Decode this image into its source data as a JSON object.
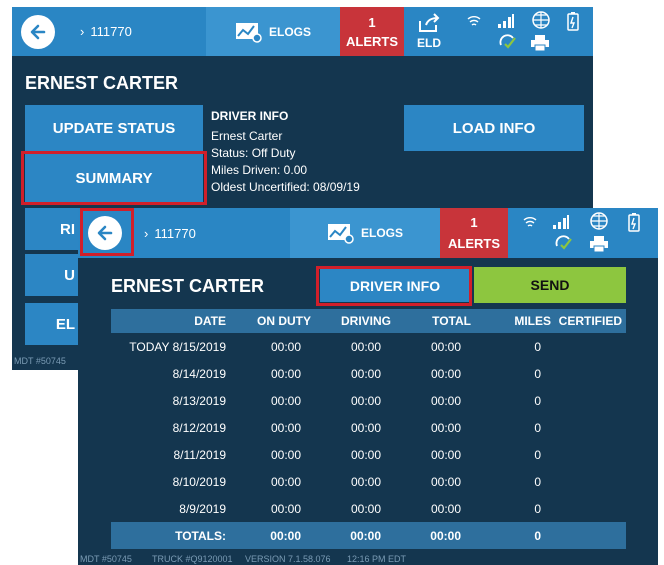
{
  "back_screen": {
    "topbar": {
      "truck_id": "111770",
      "elogs_label": "ELOGS",
      "alerts_count": "1",
      "alerts_label": "ALERTS",
      "eld_label": "ELD"
    },
    "driver_name": "ERNEST CARTER",
    "buttons": {
      "update_status": "UPDATE STATUS",
      "summary": "SUMMARY",
      "load_info": "LOAD INFO"
    },
    "partial_buttons": [
      "RI",
      "U",
      "EL"
    ],
    "driver_info": {
      "heading": "DRIVER INFO",
      "lines": [
        "Ernest Carter",
        "Status: Off Duty",
        "Miles Driven: 0.00",
        "Oldest Uncertified: 08/09/19"
      ]
    },
    "footer": "MDT #50745"
  },
  "front_screen": {
    "topbar": {
      "truck_id": "111770",
      "elogs_label": "ELOGS",
      "alerts_count": "1",
      "alerts_label": "ALERTS"
    },
    "driver_name": "ERNEST CARTER",
    "buttons": {
      "driver_info": "DRIVER INFO",
      "send": "SEND"
    },
    "table": {
      "headers": [
        "DATE",
        "ON DUTY",
        "DRIVING",
        "TOTAL",
        "MILES",
        "CERTIFIED"
      ],
      "rows": [
        [
          "TODAY 8/15/2019",
          "00:00",
          "00:00",
          "00:00",
          "0",
          ""
        ],
        [
          "8/14/2019",
          "00:00",
          "00:00",
          "00:00",
          "0",
          ""
        ],
        [
          "8/13/2019",
          "00:00",
          "00:00",
          "00:00",
          "0",
          ""
        ],
        [
          "8/12/2019",
          "00:00",
          "00:00",
          "00:00",
          "0",
          ""
        ],
        [
          "8/11/2019",
          "00:00",
          "00:00",
          "00:00",
          "0",
          ""
        ],
        [
          "8/10/2019",
          "00:00",
          "00:00",
          "00:00",
          "0",
          ""
        ],
        [
          "8/9/2019",
          "00:00",
          "00:00",
          "00:00",
          "0",
          ""
        ]
      ],
      "totals": [
        "TOTALS:",
        "00:00",
        "00:00",
        "00:00",
        "0",
        ""
      ]
    },
    "footer": {
      "mdt": "MDT #50745",
      "truck": "TRUCK #Q9120001",
      "version": "VERSION  7.1.58.076",
      "time": "12:16 PM EDT"
    }
  },
  "icons": [
    "back-arrow-icon",
    "chevron-right-icon",
    "elogs-chart-icon",
    "eld-share-icon",
    "wifi-icon",
    "signal-icon",
    "globe-icon",
    "printer-icon",
    "sync-check-icon",
    "battery-icon"
  ],
  "colors": {
    "topbar": "#2a86c4",
    "screen_bg": "#14364f",
    "button": "#2c86c4",
    "alerts": "#c8343a",
    "send": "#8dc63f",
    "highlight": "#d11f2a"
  }
}
